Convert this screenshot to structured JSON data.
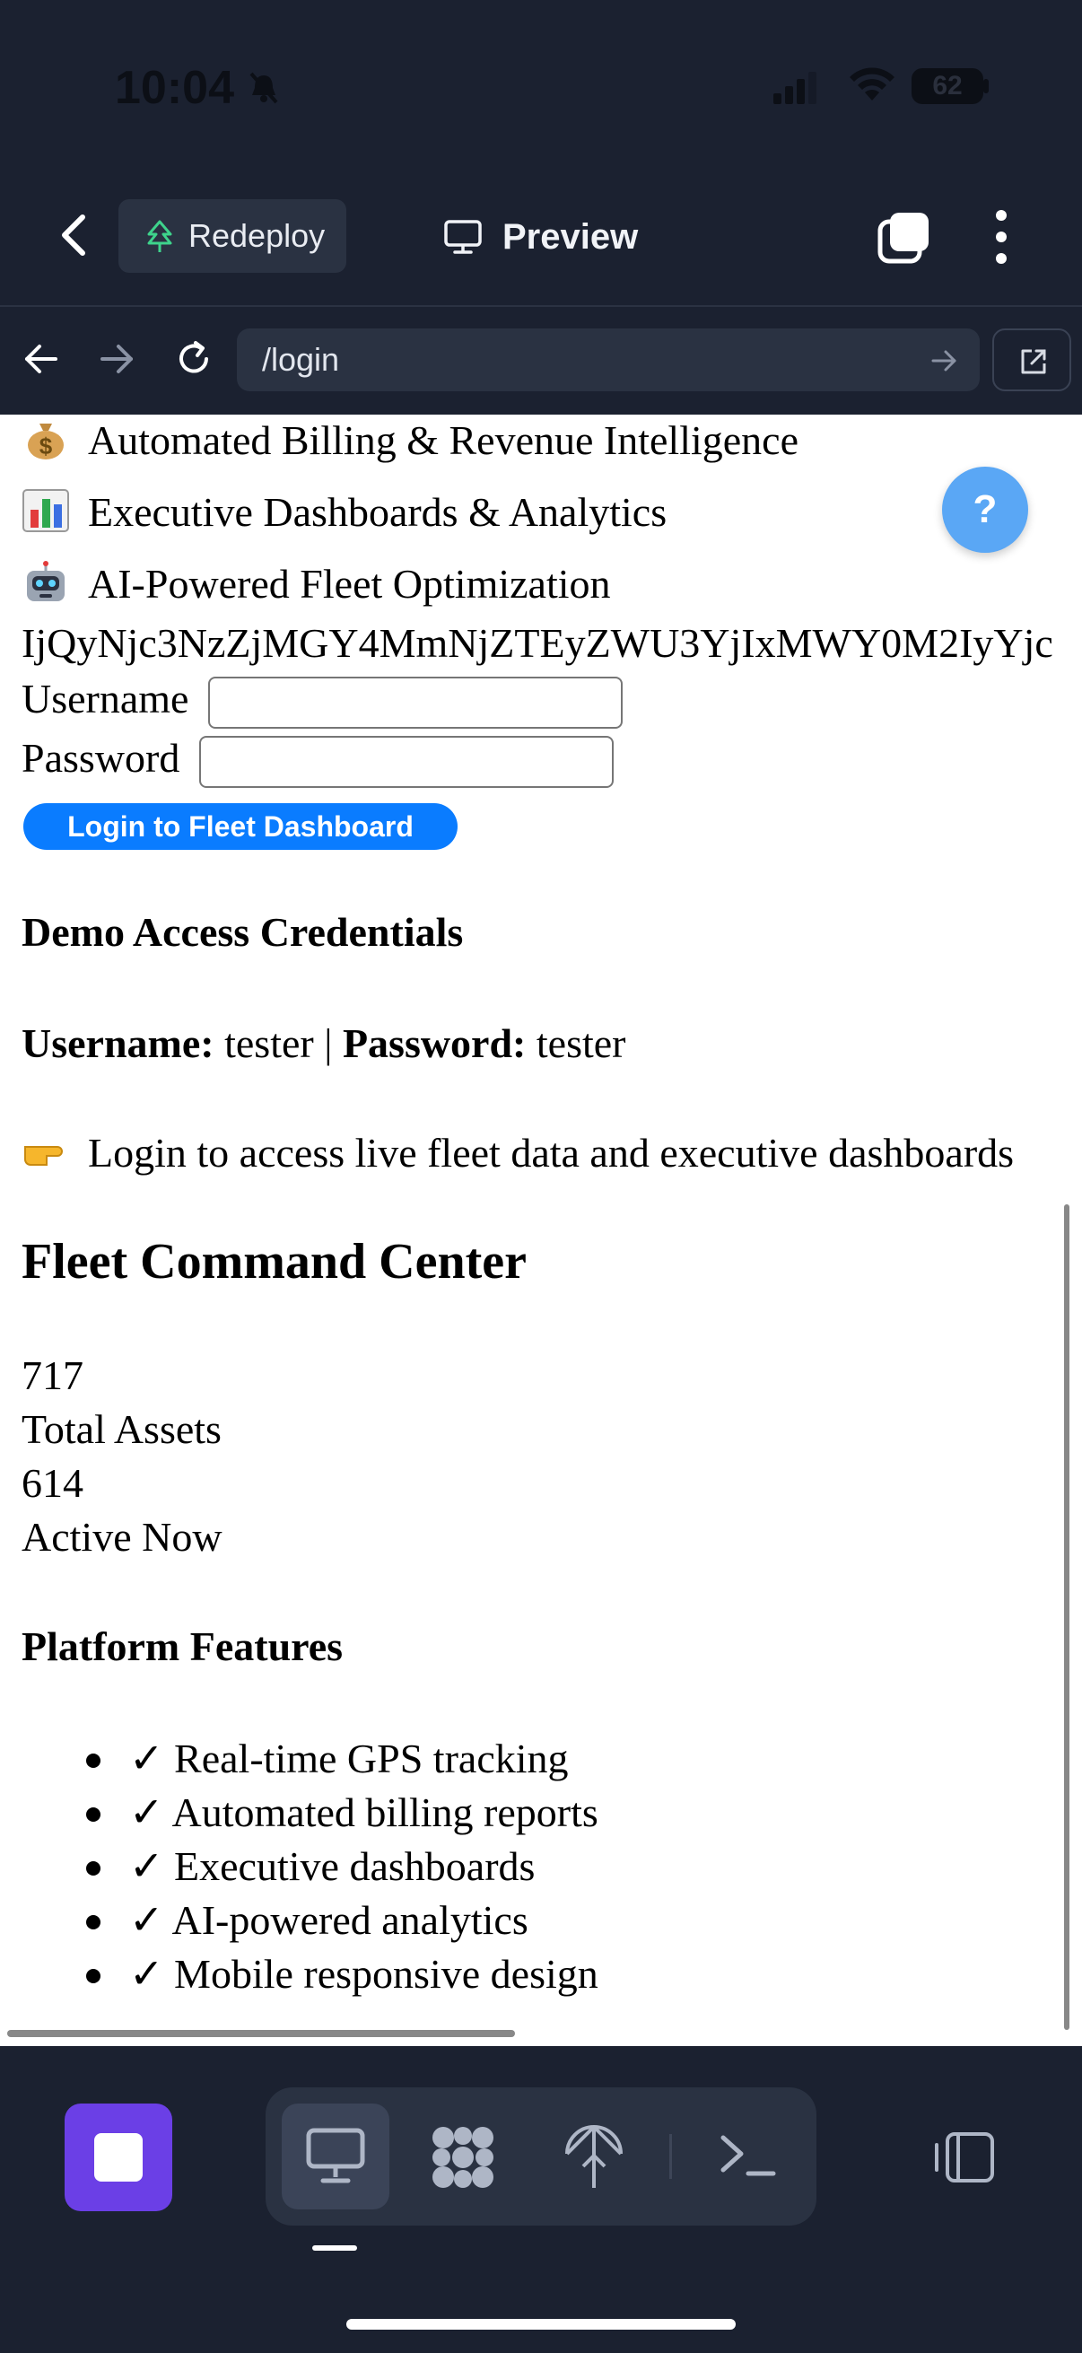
{
  "status_bar": {
    "time": "10:04",
    "battery": "62"
  },
  "header": {
    "redeploy_label": "Redeploy",
    "preview_label": "Preview"
  },
  "browser": {
    "url": "/login"
  },
  "page": {
    "features_top": [
      {
        "emoji": "money-bag",
        "text": "Automated Billing & Revenue Intelligence"
      },
      {
        "emoji": "bar-chart",
        "text": "Executive Dashboards & Analytics"
      },
      {
        "emoji": "robot",
        "text": "AI-Powered Fleet Optimization"
      }
    ],
    "token": "IjQyNjc3NzZjMGY4MmNjZTEyZWU3YjIxMWY0M2IyYjc",
    "username_label": "Username",
    "password_label": "Password",
    "login_button": "Login to Fleet Dashboard",
    "help_label": "?",
    "demo_heading": "Demo Access Credentials",
    "cred_username_label": "Username:",
    "cred_username": "tester",
    "cred_sep": "|",
    "cred_password_label": "Password:",
    "cred_password": "tester",
    "hint_text": "Login to access live fleet data and executive dashboards",
    "command_heading": "Fleet Command Center",
    "total_assets_value": "717",
    "total_assets_label": "Total Assets",
    "active_value": "614",
    "active_label": "Active Now",
    "platform_heading": "Platform Features",
    "platform_features": [
      "✓ Real-time GPS tracking",
      "✓ Automated billing reports",
      "✓ Executive dashboards",
      "✓ AI-powered analytics",
      "✓ Mobile responsive design"
    ]
  },
  "colors": {
    "dark_bg": "#1b2130",
    "accent_blue": "#0a7cff",
    "stop_purple": "#6b3fe6",
    "help_blue": "#5aa7f5"
  }
}
